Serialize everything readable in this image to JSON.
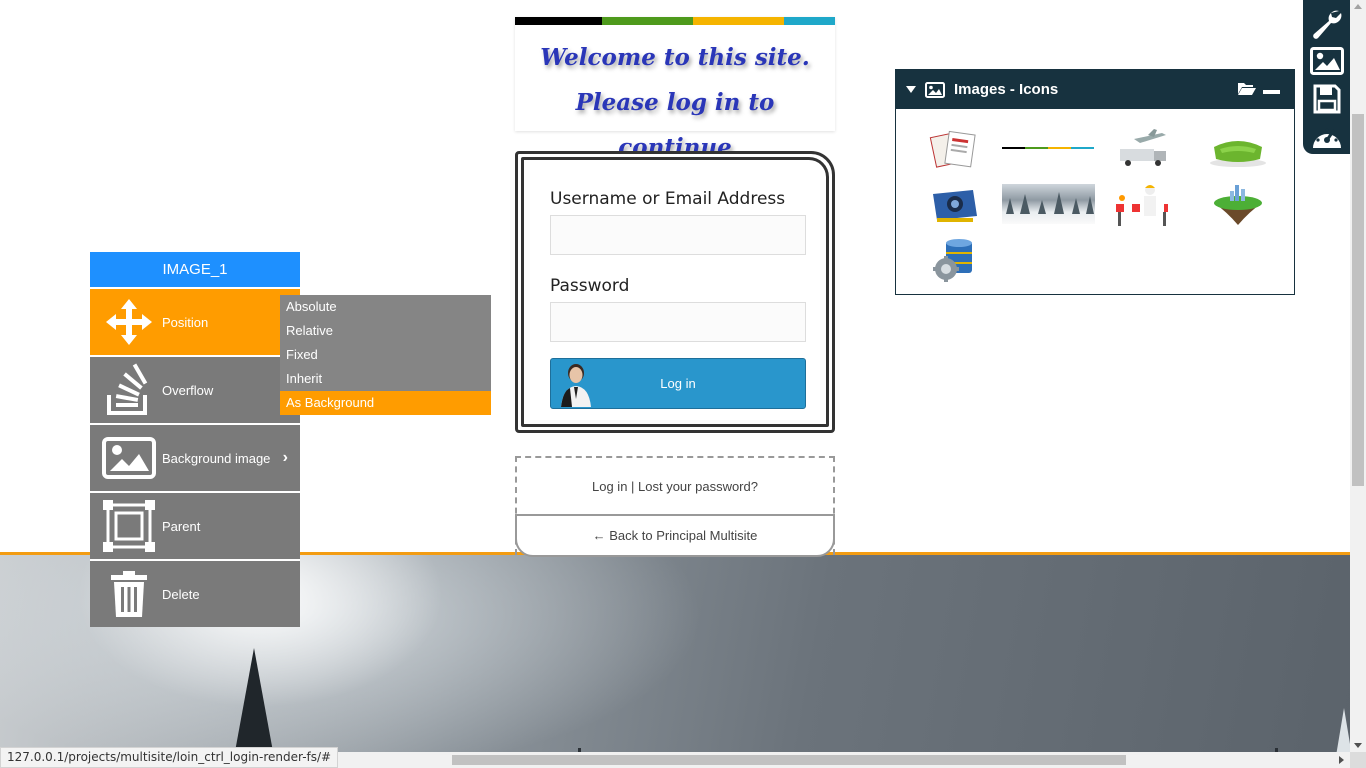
{
  "banner": {
    "stripe_colors": [
      "#000000",
      "#4e9a1c",
      "#f5b400",
      "#1fa8c9"
    ],
    "text": "Welcome to this site. Please log in to continue"
  },
  "login": {
    "username_label": "Username or Email Address",
    "username_value": "",
    "password_label": "Password",
    "password_value": "",
    "button_label": "Log in",
    "links_text": "Log in | Lost your password?",
    "back_link": "← Back to Principal Multisite"
  },
  "context_menu": {
    "title": "IMAGE_1",
    "items": [
      {
        "label": "Position",
        "icon": "move-arrows-icon",
        "active": true
      },
      {
        "label": "Overflow",
        "icon": "stack-overflow-icon"
      },
      {
        "label": "Background image",
        "icon": "image-icon",
        "has_submenu": true
      },
      {
        "label": "Parent",
        "icon": "parent-frame-icon"
      },
      {
        "label": "Delete",
        "icon": "trash-icon"
      }
    ],
    "active_color": "#ff9c00",
    "title_color": "#1e90ff"
  },
  "submenu": {
    "items": [
      "Absolute",
      "Relative",
      "Fixed",
      "Inherit",
      "As Background"
    ],
    "selected": "As Background"
  },
  "images_panel": {
    "title": "Images - Icons",
    "thumbnails": [
      "documents-thumb",
      "color-stripe-thumb",
      "truck-plane-thumb",
      "green-sofa-thumb",
      "graphics-card-thumb",
      "snowy-forest-thumb",
      "construction-worker-thumb",
      "floating-island-thumb",
      "database-gear-thumb"
    ]
  },
  "toolbar": {
    "icons": [
      "wrench-icon",
      "image-icon",
      "save-icon",
      "dashboard-icon"
    ]
  },
  "status_bar": {
    "url": "127.0.0.1/projects/multisite/loin_ctrl_login-render-fs/#"
  }
}
